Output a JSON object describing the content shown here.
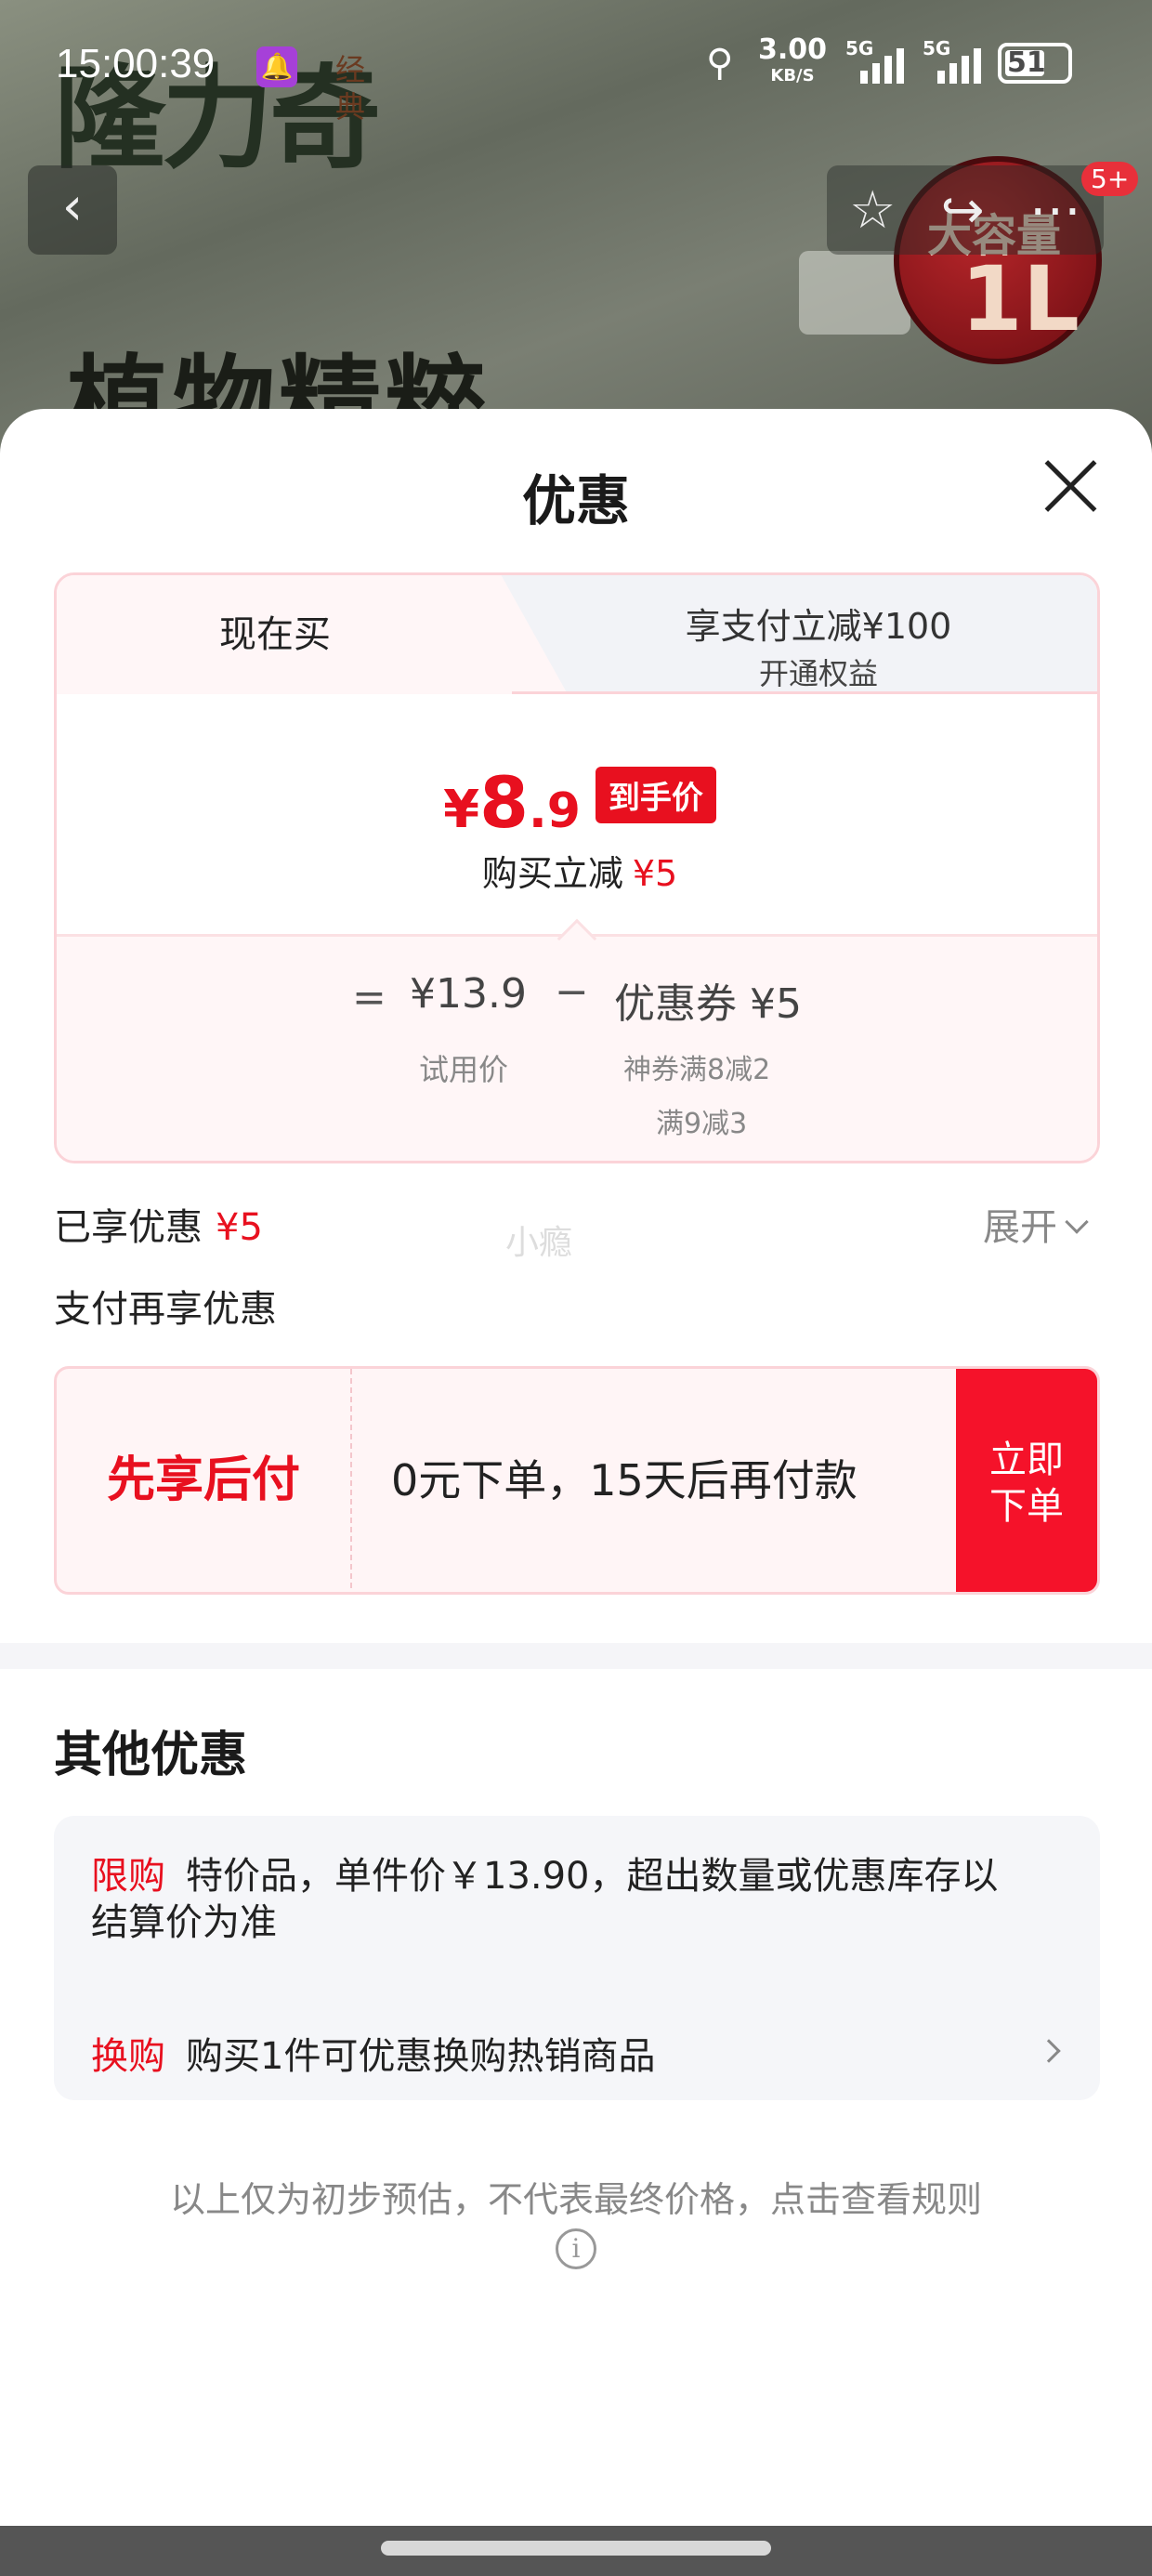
{
  "status_bar": {
    "time": "15:00:39",
    "net_speed": "3.00",
    "net_unit": "KB/S",
    "sig1_label": "5G",
    "sig2_label": "5G",
    "battery": "51"
  },
  "background": {
    "brand": "隆力奇",
    "brand_sub": "经典",
    "headline": "植物精粹",
    "badge_line1": "大容量",
    "badge_line2": "1L",
    "cart_count": "5+"
  },
  "sheet": {
    "title": "优惠"
  },
  "tabs": [
    {
      "label": "现在买"
    },
    {
      "label": "享支付立减¥100",
      "sub": "开通权益"
    }
  ],
  "price": {
    "symbol": "¥",
    "int": "8",
    "dec": ".9",
    "tag": "到手价",
    "reduce_label": "购买立减",
    "reduce_value": "¥5"
  },
  "formula": {
    "eq": "=",
    "base_value": "¥13.9",
    "minus": "−",
    "coupon_value": "优惠券 ¥5",
    "base_label": "试用价",
    "coupon_label1": "神券满8减2",
    "coupon_label2": "满9减3"
  },
  "enjoyed": {
    "label": "已享优惠",
    "value": "¥5",
    "watermark": "小瘾",
    "expand": "展开"
  },
  "pay_more_title": "支付再享优惠",
  "pay_later": {
    "title": "先享后付",
    "desc": "0元下单，15天后再付款",
    "button": "立即下单"
  },
  "other": {
    "title": "其他优惠",
    "row1_tag": "限购",
    "row1_text": "特价品，单件价￥13.90，超出数量或优惠库存以结算价为准",
    "row2_tag": "换购",
    "row2_text": "购买1件可优惠换购热销商品"
  },
  "disclaimer": "以上仅为初步预估，不代表最终价格，点击查看规则",
  "colors": {
    "accent_red": "#e8101f",
    "tag_border": "#fbd3d8"
  }
}
